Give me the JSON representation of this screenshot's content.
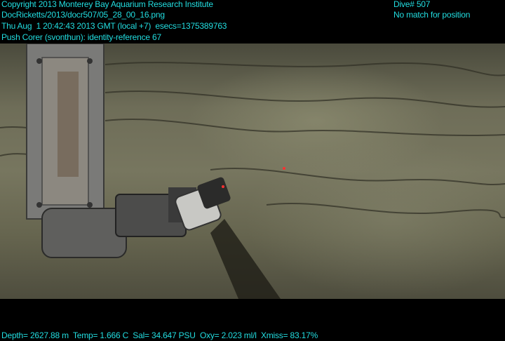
{
  "overlay": {
    "top_left": [
      "Copyright 2013 Monterey Bay Aquarium Research Institute",
      "DocRicketts/2013/docr507/05_28_00_16.png",
      "Thu Aug  1 20:42:43 2013 GMT (local +7)  esecs=1375389763",
      "Push Corer (svonthun): identity-reference 67"
    ],
    "top_right": [
      "Dive# 507",
      "No match for position"
    ],
    "bottom": "Depth= 2627.88 m  Temp= 1.666 C  Sal= 34.647 PSU  Oxy= 2.023 ml/l  Xmiss= 83.17%"
  },
  "colors": {
    "overlay_text": "#22dde0",
    "background": "#000000"
  }
}
